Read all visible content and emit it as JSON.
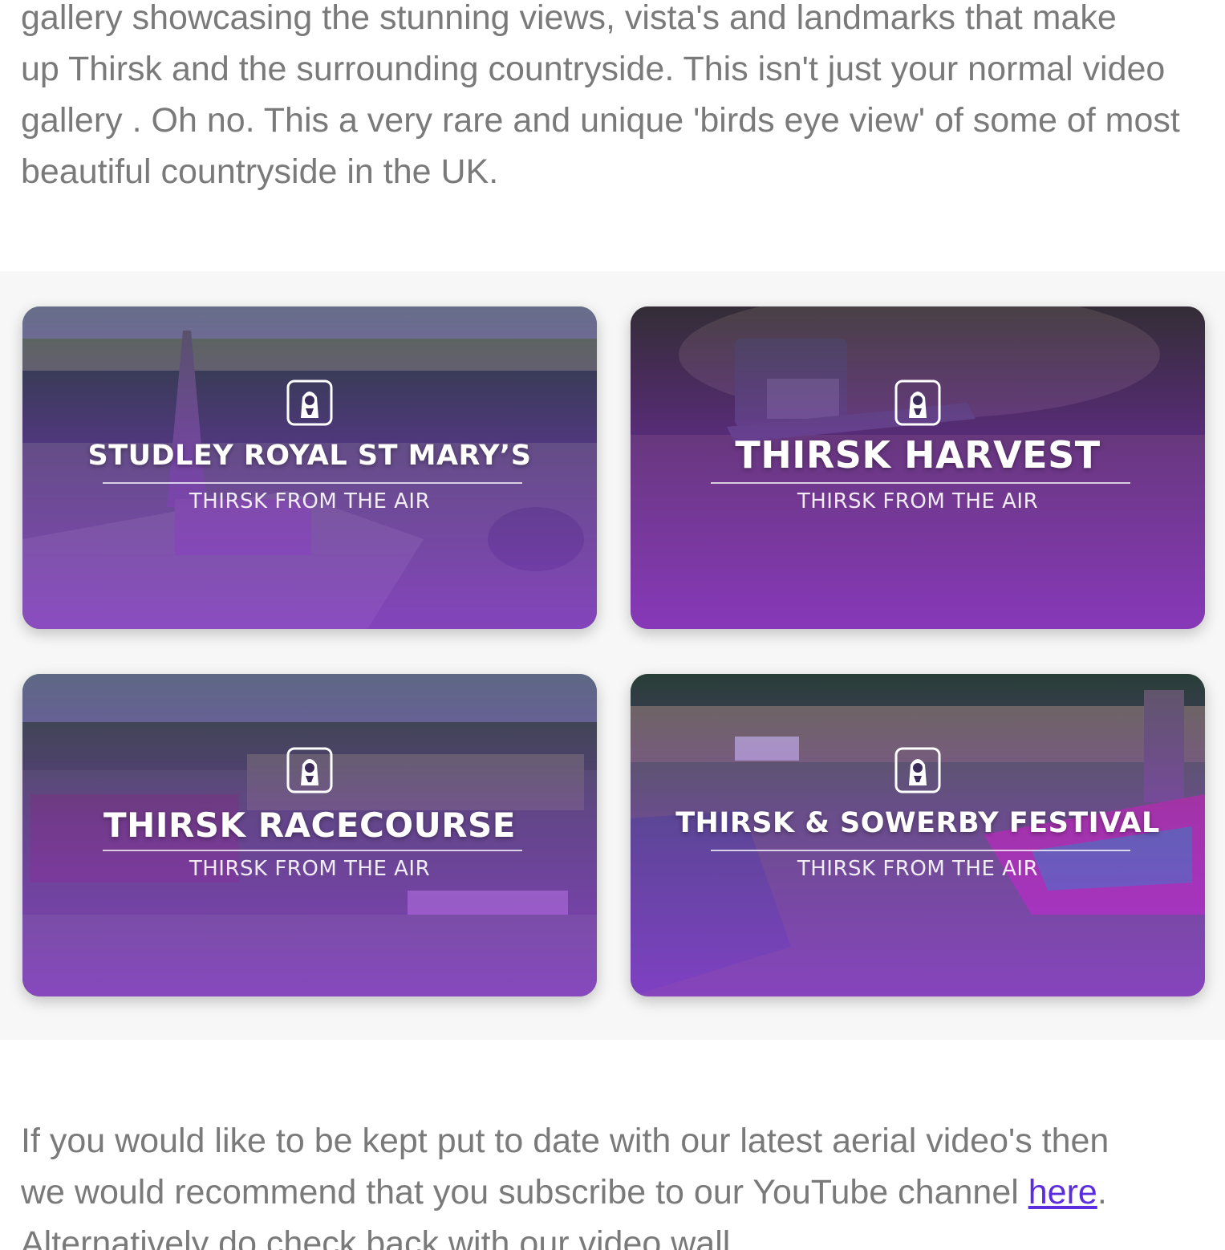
{
  "intro": {
    "lines": [
      "gallery showcasing the stunning views, vista's and landmarks that make",
      "up Thirsk and the surrounding countryside. This isn't just your normal video",
      "gallery . Oh no. This a very rare and unique 'birds eye view' of some of most",
      "beautiful countryside in the UK."
    ]
  },
  "gallery": {
    "cards": [
      {
        "title": "STUDLEY ROYAL ST MARY’S",
        "subtitle": "THIRSK FROM THE AIR",
        "logo_icon": "thirsk-from-the-air-logo-icon"
      },
      {
        "title": "THIRSK HARVEST",
        "subtitle": "THIRSK FROM THE AIR",
        "logo_icon": "thirsk-from-the-air-logo-icon"
      },
      {
        "title": "THIRSK RACECOURSE",
        "subtitle": "THIRSK FROM THE AIR",
        "logo_icon": "thirsk-from-the-air-logo-icon"
      },
      {
        "title": "THIRSK & SOWERBY FESTIVAL",
        "subtitle": "THIRSK FROM THE AIR",
        "logo_icon": "thirsk-from-the-air-logo-icon"
      }
    ]
  },
  "outro": {
    "line1": "If you would like to be kept put to date with our latest aerial video's then",
    "line2_before": "we would recommend that you subscribe to our YouTube channel ",
    "link_text": "here",
    "line2_after": ".",
    "line3": "Alternatively do check back with our video wall."
  },
  "colors": {
    "body_text": "#7a7a7a",
    "link": "#5b2ddf",
    "overlay_purple": "#9632e6",
    "gallery_bg": "#f7f7f7"
  }
}
